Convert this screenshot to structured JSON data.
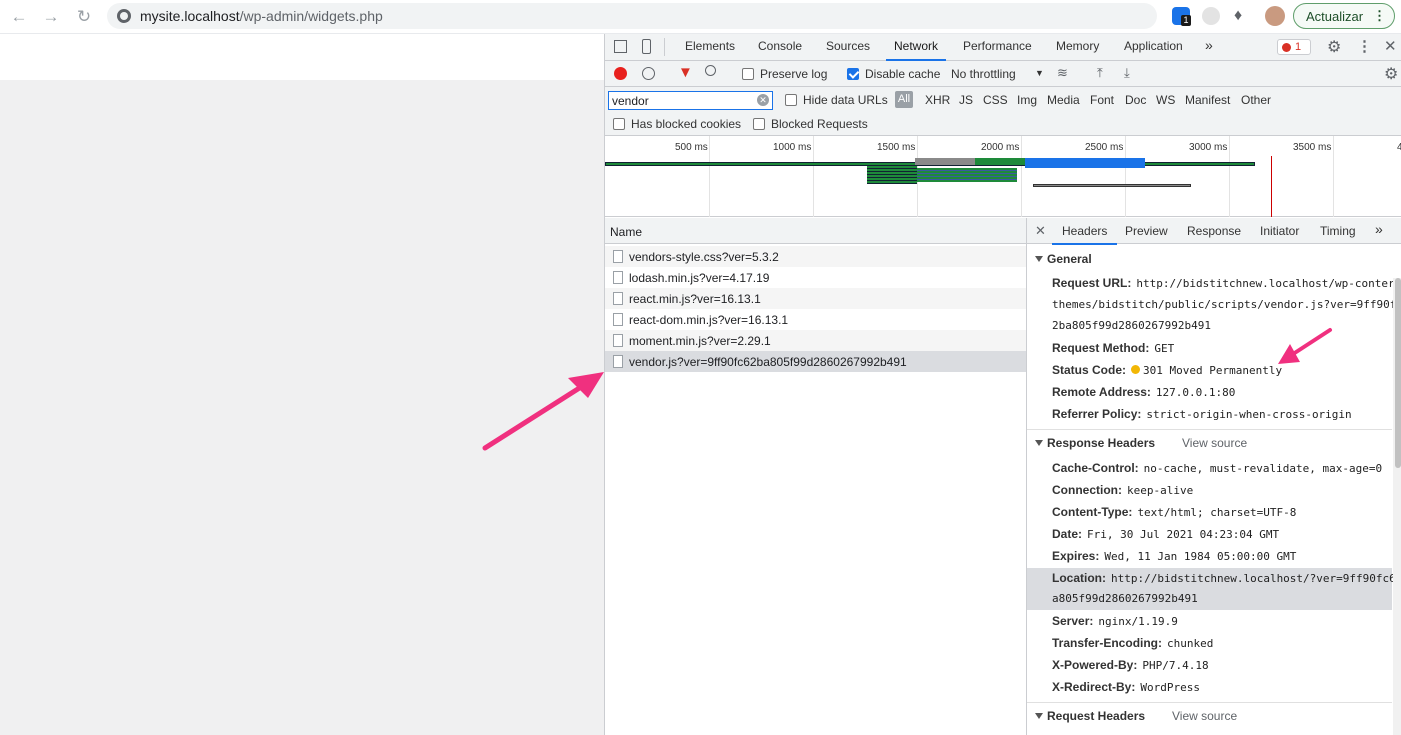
{
  "browser": {
    "url_host": "mysite.localhost",
    "url_path": "/wp-admin/widgets.php",
    "update_label": "Actualizar",
    "ext_badge": "1"
  },
  "devtools": {
    "tabs": [
      "Elements",
      "Console",
      "Sources",
      "Network",
      "Performance",
      "Memory",
      "Application"
    ],
    "active_tab": "Network",
    "error_count": "1",
    "toolbar": {
      "preserve_log": "Preserve log",
      "disable_cache": "Disable cache",
      "throttling": "No throttling"
    },
    "filter": {
      "value": "vendor",
      "hide_data_urls": "Hide data URLs",
      "all": "All",
      "types": [
        "XHR",
        "JS",
        "CSS",
        "Img",
        "Media",
        "Font",
        "Doc",
        "WS",
        "Manifest",
        "Other"
      ],
      "blocked_cookies": "Has blocked cookies",
      "blocked_requests": "Blocked Requests"
    },
    "timeline_ticks": [
      "500 ms",
      "1000 ms",
      "1500 ms",
      "2000 ms",
      "2500 ms",
      "3000 ms",
      "3500 ms",
      "4"
    ],
    "name_header": "Name",
    "requests": [
      "vendors-style.css?ver=5.3.2",
      "lodash.min.js?ver=4.17.19",
      "react.min.js?ver=16.13.1",
      "react-dom.min.js?ver=16.13.1",
      "moment.min.js?ver=2.29.1",
      "vendor.js?ver=9ff90fc62ba805f99d2860267992b491"
    ],
    "detail_tabs": [
      "Headers",
      "Preview",
      "Response",
      "Initiator",
      "Timing"
    ],
    "general": {
      "title": "General",
      "request_url_key": "Request URL:",
      "request_url_l1": "http://bidstitchnew.localhost/wp-conter",
      "request_url_l2": "themes/bidstitch/public/scripts/vendor.js?ver=9ff90f",
      "request_url_l3": "2ba805f99d2860267992b491",
      "method_key": "Request Method:",
      "method_val": "GET",
      "status_key": "Status Code:",
      "status_val": "301 Moved Permanently",
      "remote_key": "Remote Address:",
      "remote_val": "127.0.0.1:80",
      "referrer_key": "Referrer Policy:",
      "referrer_val": "strict-origin-when-cross-origin"
    },
    "response_headers": {
      "title": "Response Headers",
      "view_source": "View source",
      "cache_key": "Cache-Control:",
      "cache_val": "no-cache, must-revalidate, max-age=0",
      "conn_key": "Connection:",
      "conn_val": "keep-alive",
      "ctype_key": "Content-Type:",
      "ctype_val": "text/html; charset=UTF-8",
      "date_key": "Date:",
      "date_val": "Fri, 30 Jul 2021 04:23:04 GMT",
      "expires_key": "Expires:",
      "expires_val": "Wed, 11 Jan 1984 05:00:00 GMT",
      "location_key": "Location:",
      "location_l1": "http://bidstitchnew.localhost/?ver=9ff90fc6",
      "location_l2": "a805f99d2860267992b491",
      "server_key": "Server:",
      "server_val": "nginx/1.19.9",
      "te_key": "Transfer-Encoding:",
      "te_val": "chunked",
      "xpb_key": "X-Powered-By:",
      "xpb_val": "PHP/7.4.18",
      "xrb_key": "X-Redirect-By:",
      "xrb_val": "WordPress"
    },
    "request_headers": {
      "title": "Request Headers",
      "view_source": "View source"
    }
  },
  "colors": {
    "annotation_arrow": "#f0307f",
    "accent": "#1a73e8",
    "record": "#e8201d"
  }
}
